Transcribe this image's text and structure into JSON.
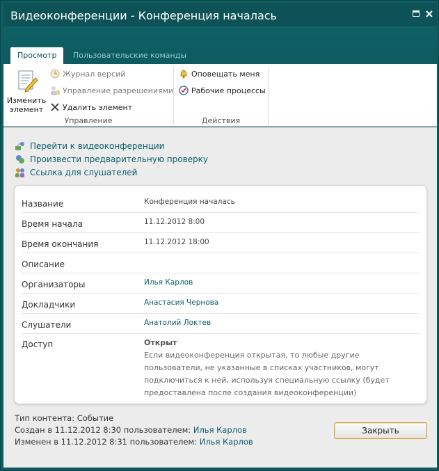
{
  "window": {
    "title": "Видеоконференции - Конференция началась"
  },
  "ribbon": {
    "tabs": [
      {
        "label": "Просмотр",
        "active": true
      },
      {
        "label": "Пользовательские команды",
        "active": false
      }
    ],
    "groups": {
      "manage": {
        "label": "Управление",
        "edit_item": "Изменить элемент",
        "edit_item_line1": "Изменить",
        "edit_item_line2": "элемент",
        "version_history": "Журнал версий",
        "manage_permissions": "Управление разрешениями",
        "delete_item": "Удалить элемент"
      },
      "actions": {
        "label": "Действия",
        "alert_me": "Оповещать меня",
        "workflows": "Рабочие процессы"
      }
    }
  },
  "links": [
    {
      "label": "Перейти к видеоконференции",
      "icon": "video-link-icon"
    },
    {
      "label": "Произвести предварительную проверку",
      "icon": "check-link-icon"
    },
    {
      "label": "Ссылка для слушателей",
      "icon": "people-link-icon"
    }
  ],
  "fields": {
    "title": {
      "label": "Название",
      "value": "Конференция началась"
    },
    "start_time": {
      "label": "Время начала",
      "value": "11.12.2012 8:00"
    },
    "end_time": {
      "label": "Время окончания",
      "value": "11.12.2012 18:00"
    },
    "description": {
      "label": "Описание",
      "value": ""
    },
    "organizers": {
      "label": "Организаторы",
      "value": "Илья Карлов"
    },
    "speakers": {
      "label": "Докладчики",
      "value": "Анастасия Чернова"
    },
    "listeners": {
      "label": "Слушатели",
      "value": "Анатолий Локтев"
    },
    "access": {
      "label": "Доступ",
      "value": "Открыт",
      "description_lines": [
        "Если видеоконференция открытая, то любые другие",
        "пользователи, не указанные в списках участников, могут",
        "подключиться к ней, используя специальную ссылку (будет",
        "предоставлена после создания видеоконференции)"
      ]
    }
  },
  "meta": {
    "content_type": "Тип контента: Событие",
    "created_prefix": "Создан в 11.12.2012 8:30 пользователем: ",
    "created_user": "Илья Карлов",
    "modified_prefix": "Изменен в 11.12.2012 8:31 пользователем: ",
    "modified_user": "Илья Карлов"
  },
  "buttons": {
    "close": "Закрыть"
  },
  "colors": {
    "header": "#0f5d61",
    "link": "#0b5d6c",
    "content_bg": "#ececec"
  }
}
